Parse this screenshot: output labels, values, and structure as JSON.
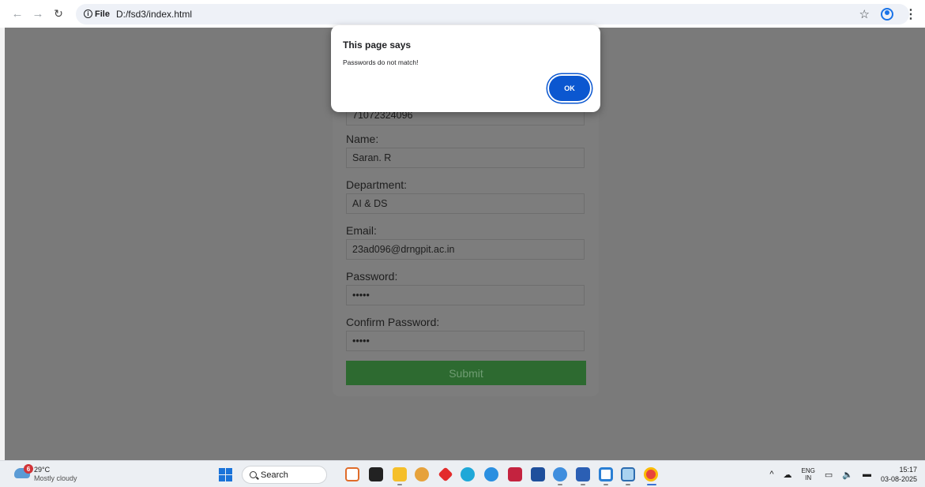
{
  "browser": {
    "url_scheme": "File",
    "url": "D:/fsd3/index.html"
  },
  "form": {
    "fields": [
      {
        "label": "",
        "value": "71072324096"
      },
      {
        "label": "Name:",
        "value": "Saran. R"
      },
      {
        "label": "Department:",
        "value": "AI & DS"
      },
      {
        "label": "Email:",
        "value": "23ad096@drngpit.ac.in"
      },
      {
        "label": "Password:",
        "value": "•••••"
      },
      {
        "label": "Confirm Password:",
        "value": "•••••"
      }
    ],
    "submit_label": "Submit",
    "submit_color": "#2d6a30"
  },
  "dialog": {
    "title": "This page says",
    "message": "Passwords do not match!",
    "ok_label": "OK",
    "accent": "#0b57d0"
  },
  "taskbar": {
    "weather": {
      "badge": "6",
      "temp": "29°C",
      "desc": "Mostly cloudy"
    },
    "search_label": "Search",
    "tray": {
      "lang_top": "ENG",
      "lang_bottom": "IN",
      "time": "15:17",
      "date": "03-08-2025"
    }
  }
}
